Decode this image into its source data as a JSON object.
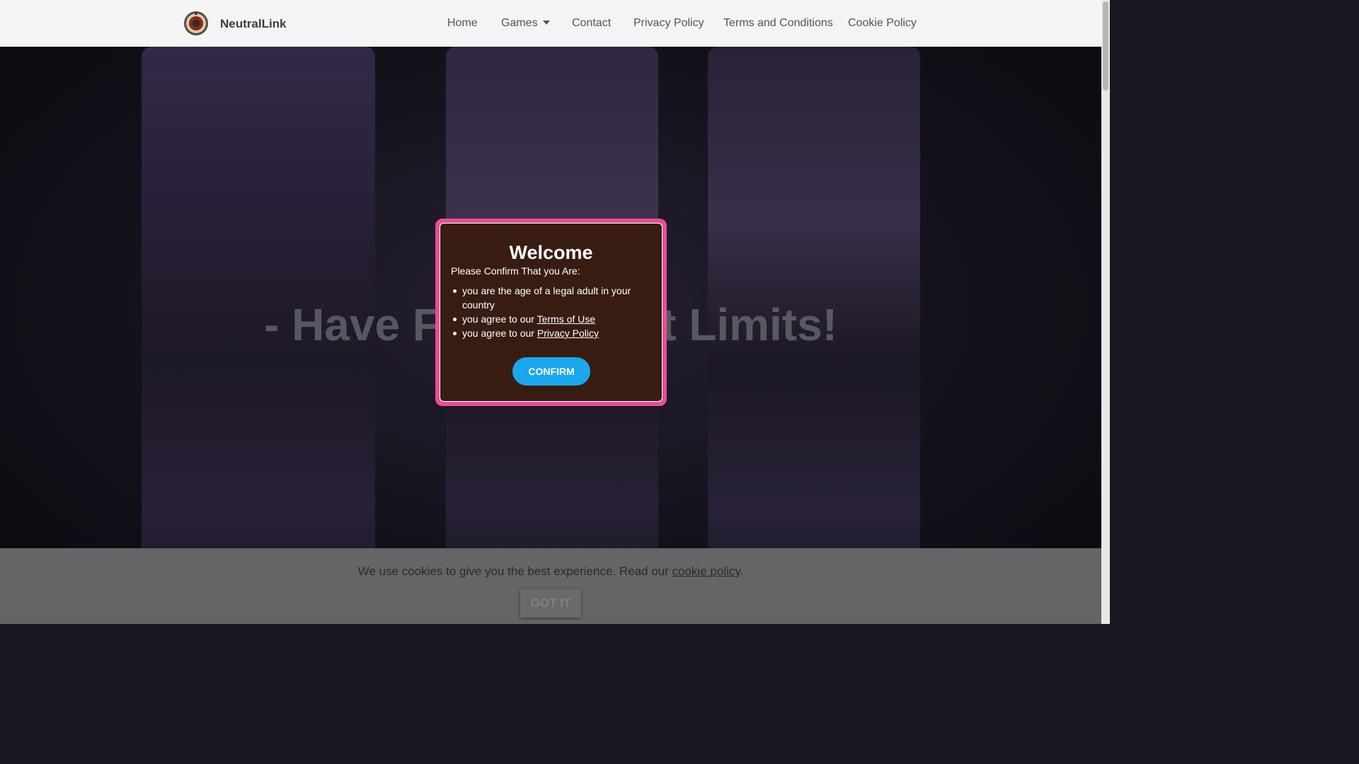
{
  "header": {
    "brand": "NeutralLink",
    "nav": {
      "home": "Home",
      "games": "Games",
      "contact": "Contact",
      "privacy": "Privacy Policy",
      "terms": "Terms and Conditions",
      "cookie": "Cookie Policy"
    }
  },
  "hero": {
    "title": "- Have Fun Without Limits!"
  },
  "modal": {
    "title": "Welcome",
    "subtitle": "Please Confirm That you Are:",
    "items": {
      "adult": "you are the age of a legal adult in your country",
      "terms_prefix": "you agree to our ",
      "terms_link": "Terms of Use",
      "privacy_prefix": "you agree to our ",
      "privacy_link": "Privacy Policy"
    },
    "confirm_label": "CONFIRM"
  },
  "cookie_bar": {
    "text": "We use cookies to give you the best experience. Read our ",
    "link": "cookie policy",
    "suffix": ".",
    "button": "GOT IT"
  },
  "colors": {
    "modal_border": "#e84c9b",
    "modal_bg": "#381c12",
    "confirm_button": "#1aa7ec",
    "cookie_bar": "#656565"
  },
  "icons": {
    "logo": "roulette-wheel-icon",
    "dropdown": "caret-down-icon"
  }
}
